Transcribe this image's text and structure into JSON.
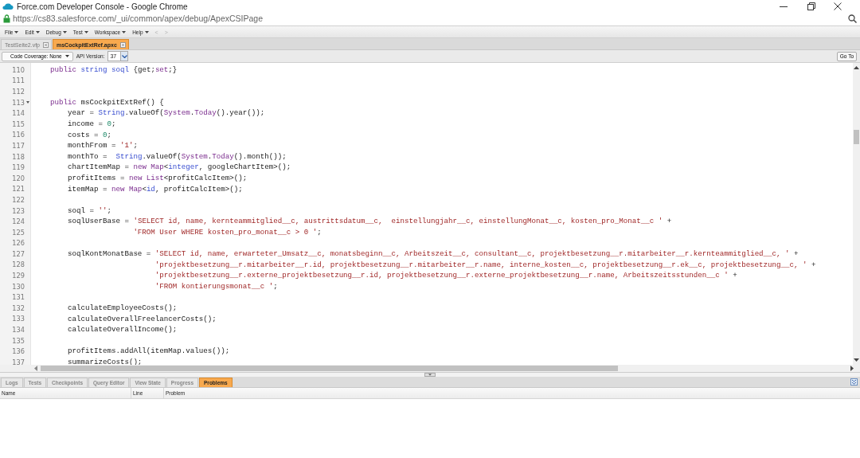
{
  "window": {
    "title": "Force.com Developer Console - Google Chrome"
  },
  "address_bar": {
    "url": "https://cs83.salesforce.com/_ui/common/apex/debug/ApexCSIPage",
    "secure": true
  },
  "menu": [
    {
      "label": "File"
    },
    {
      "label": "Edit"
    },
    {
      "label": "Debug"
    },
    {
      "label": "Test"
    },
    {
      "label": "Workspace"
    },
    {
      "label": "Help"
    }
  ],
  "nav": [
    {
      "label": "<",
      "disabled": true
    },
    {
      "label": ">",
      "disabled": true
    }
  ],
  "file_tabs": [
    {
      "label": "TestSeite2.vfp",
      "selected": false
    },
    {
      "label": "msCockpitExtRef.apxc",
      "selected": true
    }
  ],
  "toolbar": {
    "coverage": "Code Coverage: None",
    "api_label": "API Version:",
    "api_value": "37",
    "goto": "Go To"
  },
  "code_lines": [
    {
      "number": "110",
      "foldable": false,
      "tokens": [
        {
          "kind": "keyword",
          "text": "    public"
        },
        {
          "kind": "type",
          "text": " string"
        },
        {
          "kind": "type",
          "text": " soql"
        },
        {
          "kind": "plain",
          "text": " {get;"
        },
        {
          "kind": "keyword",
          "text": "set"
        },
        {
          "kind": "plain",
          "text": ";}"
        }
      ]
    },
    {
      "number": "111",
      "foldable": false
    },
    {
      "number": "112",
      "foldable": false
    },
    {
      "number": "113",
      "foldable": true,
      "tokens": [
        {
          "kind": "keyword",
          "text": "    public"
        },
        {
          "kind": "plain",
          "text": " msCockpitExtRef() {"
        }
      ]
    },
    {
      "number": "114",
      "foldable": false,
      "tokens": [
        {
          "kind": "plain",
          "text": "        year = "
        },
        {
          "kind": "type",
          "text": "String"
        },
        {
          "kind": "plain",
          "text": ".valueOf("
        },
        {
          "kind": "keyword",
          "text": "System"
        },
        {
          "kind": "plain",
          "text": "."
        },
        {
          "kind": "keyword",
          "text": "Today"
        },
        {
          "kind": "plain",
          "text": "().year());"
        }
      ]
    },
    {
      "number": "115",
      "foldable": false,
      "tokens": [
        {
          "kind": "plain",
          "text": "        income = "
        },
        {
          "kind": "number",
          "text": "0"
        },
        {
          "kind": "plain",
          "text": ";"
        }
      ]
    },
    {
      "number": "116",
      "foldable": false,
      "tokens": [
        {
          "kind": "plain",
          "text": "        costs = "
        },
        {
          "kind": "number",
          "text": "0"
        },
        {
          "kind": "plain",
          "text": ";"
        }
      ]
    },
    {
      "number": "117",
      "foldable": false,
      "tokens": [
        {
          "kind": "plain",
          "text": "        monthFrom = "
        },
        {
          "kind": "string",
          "text": "'1'"
        },
        {
          "kind": "plain",
          "text": ";"
        }
      ]
    },
    {
      "number": "118",
      "foldable": false,
      "tokens": [
        {
          "kind": "plain",
          "text": "        monthTo =  "
        },
        {
          "kind": "type",
          "text": "String"
        },
        {
          "kind": "plain",
          "text": ".valueOf("
        },
        {
          "kind": "keyword",
          "text": "System"
        },
        {
          "kind": "plain",
          "text": "."
        },
        {
          "kind": "keyword",
          "text": "Today"
        },
        {
          "kind": "plain",
          "text": "().month());"
        }
      ]
    },
    {
      "number": "119",
      "foldable": false,
      "tokens": [
        {
          "kind": "plain",
          "text": "        chartItemMap = "
        },
        {
          "kind": "keyword",
          "text": "new"
        },
        {
          "kind": "keyword",
          "text": " Map"
        },
        {
          "kind": "plain",
          "text": "<"
        },
        {
          "kind": "type",
          "text": "integer"
        },
        {
          "kind": "plain",
          "text": ", googleChartItem>();"
        }
      ]
    },
    {
      "number": "120",
      "foldable": false,
      "tokens": [
        {
          "kind": "plain",
          "text": "        profitItems = "
        },
        {
          "kind": "keyword",
          "text": "new"
        },
        {
          "kind": "keyword",
          "text": " List"
        },
        {
          "kind": "plain",
          "text": "<profitCalcItem>();"
        }
      ]
    },
    {
      "number": "121",
      "foldable": false,
      "tokens": [
        {
          "kind": "plain",
          "text": "        itemMap = "
        },
        {
          "kind": "keyword",
          "text": "new"
        },
        {
          "kind": "keyword",
          "text": " Map"
        },
        {
          "kind": "plain",
          "text": "<"
        },
        {
          "kind": "type",
          "text": "id"
        },
        {
          "kind": "plain",
          "text": ", profitCalcItem>();"
        }
      ]
    },
    {
      "number": "122",
      "foldable": false
    },
    {
      "number": "123",
      "foldable": false,
      "tokens": [
        {
          "kind": "plain",
          "text": "        soql = "
        },
        {
          "kind": "string",
          "text": "''"
        },
        {
          "kind": "plain",
          "text": ";"
        }
      ]
    },
    {
      "number": "124",
      "foldable": false,
      "tokens": [
        {
          "kind": "plain",
          "text": "        soqlUserBase = "
        },
        {
          "kind": "string",
          "text": "'SELECT id, name, kernteammitglied__c, austrittsdatum__c,  einstellungjahr__c, einstellungMonat__c, kosten_pro_Monat__c '"
        },
        {
          "kind": "plain",
          "text": " +"
        }
      ]
    },
    {
      "number": "125",
      "foldable": false,
      "tokens": [
        {
          "kind": "string",
          "text": "                       'FROM User WHERE kosten_pro_monat__c > 0 '"
        },
        {
          "kind": "plain",
          "text": ";"
        }
      ]
    },
    {
      "number": "126",
      "foldable": false
    },
    {
      "number": "127",
      "foldable": false,
      "tokens": [
        {
          "kind": "plain",
          "text": "        soqlKontMonatBase = "
        },
        {
          "kind": "string",
          "text": "'SELECT id, name, erwarteter_Umsatz__c, monatsbeginn__c, Arbeitszeit__c, consultant__c, projektbesetzung__r.mitarbeiter__r.kernteammitglied__c, '"
        },
        {
          "kind": "plain",
          "text": " +"
        }
      ]
    },
    {
      "number": "128",
      "foldable": false,
      "tokens": [
        {
          "kind": "string",
          "text": "                            'projektbesetzung__r.mitarbeiter__r.id, projektbesetzung__r.mitarbeiter__r.name, interne_kosten__c, projektbesetzung__r.ek__c, projektbesetzung__c, '"
        },
        {
          "kind": "plain",
          "text": " +"
        }
      ]
    },
    {
      "number": "129",
      "foldable": false,
      "tokens": [
        {
          "kind": "string",
          "text": "                            'projektbesetzung__r.externe_projektbesetzung__r.id, projektbesetzung__r.externe_projektbesetzung__r.name, Arbeitszeitsstunden__c '"
        },
        {
          "kind": "plain",
          "text": " +"
        }
      ]
    },
    {
      "number": "130",
      "foldable": false,
      "tokens": [
        {
          "kind": "string",
          "text": "                            'FROM kontierungsmonat__c '"
        },
        {
          "kind": "plain",
          "text": ";"
        }
      ]
    },
    {
      "number": "131",
      "foldable": false
    },
    {
      "number": "132",
      "foldable": false,
      "tokens": [
        {
          "kind": "plain",
          "text": "        calculateEmployeeCosts();"
        }
      ]
    },
    {
      "number": "133",
      "foldable": false,
      "tokens": [
        {
          "kind": "plain",
          "text": "        calculateOverallFreelancerCosts();"
        }
      ]
    },
    {
      "number": "134",
      "foldable": false,
      "tokens": [
        {
          "kind": "plain",
          "text": "        calculateOverallIncome();"
        }
      ]
    },
    {
      "number": "135",
      "foldable": false
    },
    {
      "number": "136",
      "foldable": false,
      "tokens": [
        {
          "kind": "plain",
          "text": "        profitItems.addAll(itemMap.values());"
        }
      ]
    },
    {
      "number": "137",
      "foldable": false,
      "tokens": [
        {
          "kind": "plain",
          "text": "        summarizeCosts();"
        }
      ]
    }
  ],
  "bottom_tabs": [
    {
      "label": "Logs",
      "selected": false
    },
    {
      "label": "Tests",
      "selected": false
    },
    {
      "label": "Checkpoints",
      "selected": false
    },
    {
      "label": "Query Editor",
      "selected": false
    },
    {
      "label": "View State",
      "selected": false
    },
    {
      "label": "Progress",
      "selected": false
    },
    {
      "label": "Problems",
      "selected": true
    }
  ],
  "problems_table": {
    "columns": [
      "Name",
      "Line",
      "Problem"
    ]
  }
}
